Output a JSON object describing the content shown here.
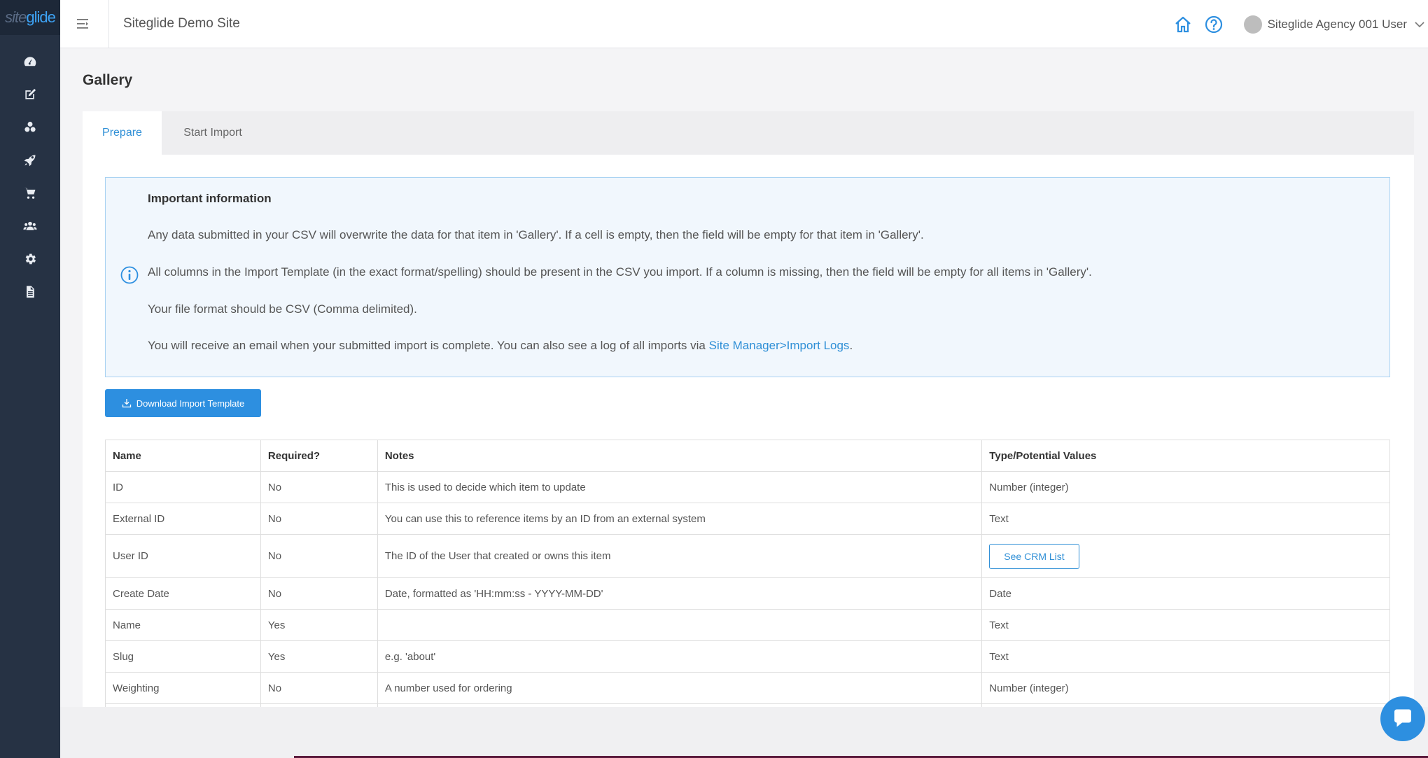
{
  "brand": {
    "logo_part1": "site",
    "logo_part2": "glide"
  },
  "header": {
    "site_title": "Siteglide Demo Site",
    "user_name": "Siteglide Agency 001 User"
  },
  "page": {
    "title": "Gallery"
  },
  "tabs": [
    {
      "label": "Prepare",
      "active": true
    },
    {
      "label": "Start Import",
      "active": false
    }
  ],
  "info": {
    "title": "Important information",
    "line1": "Any data submitted in your CSV will overwrite the data for that item in 'Gallery'. If a cell is empty, then the field will be empty for that item in 'Gallery'.",
    "line2": "All columns in the Import Template (in the exact format/spelling) should be present in the CSV you import. If a column is missing, then the field will be empty for all items in 'Gallery'.",
    "line3": "Your file format should be CSV (Comma delimited).",
    "line4_prefix": "You will receive an email when your submitted import is complete. You can also see a log of all imports via ",
    "line4_link": "Site Manager>Import Logs",
    "line4_suffix": "."
  },
  "download_button": "Download Import Template",
  "table": {
    "headers": [
      "Name",
      "Required?",
      "Notes",
      "Type/Potential Values"
    ],
    "rows": [
      {
        "name": "ID",
        "required": "No",
        "notes": "This is used to decide which item to update",
        "type": "Number (integer)"
      },
      {
        "name": "External ID",
        "required": "No",
        "notes": "You can use this to reference items by an ID from an external system",
        "type": "Text"
      },
      {
        "name": "User ID",
        "required": "No",
        "notes": "The ID of the User that created or owns this item",
        "type_button": "See CRM List"
      },
      {
        "name": "Create Date",
        "required": "No",
        "notes": "Date, formatted as 'HH:mm:ss - YYYY-MM-DD'",
        "type": "Date"
      },
      {
        "name": "Name",
        "required": "Yes",
        "notes": "",
        "type": "Text"
      },
      {
        "name": "Slug",
        "required": "Yes",
        "notes": "e.g. 'about'",
        "type": "Text"
      },
      {
        "name": "Weighting",
        "required": "No",
        "notes": "A number used for ordering",
        "type": "Number (integer)"
      }
    ]
  },
  "colors": {
    "accent": "#2d8fe0",
    "sidebar": "#263244",
    "info_bg": "#f1f7fd"
  },
  "sidebar_icons": [
    "dashboard-icon",
    "edit-icon",
    "modules-icon",
    "rocket-icon",
    "cart-icon",
    "users-icon",
    "settings-icon",
    "file-icon"
  ]
}
